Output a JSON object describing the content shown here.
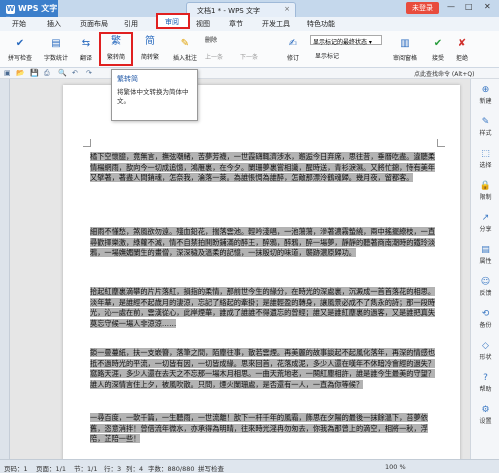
{
  "titlebar": {
    "app": "WPS 文字",
    "doc_tab": "文档1 * - WPS 文字",
    "login": "未登录",
    "min": "—",
    "max": "□",
    "close": "✕"
  },
  "menu": [
    "开始",
    "插入",
    "页面布局",
    "引用",
    "审阅",
    "视图",
    "章节",
    "开发工具",
    "特色功能"
  ],
  "menu_active": "审阅",
  "ribbon": {
    "spellcheck": "拼写检查",
    "wordcount": "字数统计",
    "translate": "翻译",
    "trad_to_simp": "繁转简",
    "simp_to_trad": "简转繁",
    "insert_comment": "插入批注",
    "delete": "删除",
    "prev": "上一条",
    "next": "下一条",
    "revise": "修订",
    "show_markup_select": "显示标记的最终状态",
    "show_markup": "显示标记",
    "review_pane": "审阅窗格",
    "accept": "接受",
    "reject": "拒绝"
  },
  "tooltip": {
    "title": "繁转简",
    "desc": "将繁体中文转换为简体中文。"
  },
  "toolbar2": {
    "search": "点此查找命令 (Alt+Q)"
  },
  "document": {
    "paragraphs": [
      "橘下空懷臆，竟無言，撫弦嘲緒，苦夢芳襪，一世霞礴輒濟涉水，邂逅今日弃席，思往昔，垂曆吃盡。違聽柔情楊網雨，歆向今一切成追憶，鴻雁裏，在今夕。闌珊夢裏嘗相識，醒時送，青衫淚濕。又將忙錦，恃有美年又擘著，著盡人間銷魂，怎奈我，淪落一萊。為誰悵惆為誰醉，怎敵那漂泠鶴魂歸。幾月夜，留都客。",
      "細雨不懂愁，煞風欲勿遠。殘血鉛花，揣落雲池。輕吟淺唱，一池蕩蕩，滲著濃霧蟄繞，兩中搖擺繚枝，一直尋歡擇樂激，綠蘿不滅，情不自禁拍鬨盼鋪滿的醉王，醉鴉，醉鴉，醉一場夢，靜靜的聽著商南潮時的鐵玲淡鴉，一場嫵媚闌生的畫僧，深深穢及溫柔的記憶，一抹殷切的味道，襲跡濃原歸功。",
      "拾起紅塵裏滴攀的片片落紅，損指的柔情，那前世今生的緣分，在時光的深處裏，沉澱成一首首落花的相思。淡年華，是誰經不起歲月的淒涼，忘記了絡起的牽掛；是誰輕盈的轉身，讓風景必成不了雋永的詩；那一段時光，沁一處在前，雲漢從心，此岸煙華，誰成了誰誰不得遺忘的曾經；誰又是誰紅塵裏的過客，又是誰把真失莫忘守候一場人非涼涼……",
      "鎖一曼蔓紙，扶一支嵌簪，落筆之間，陌塵往事，散若雲煙。再美麗的故事談起不起風化落年，再深的情感也抵不過時光的平流，一切皆有因，一切皆成緣。思來回首，花落成泥，多少人還在嘆年不休暗冷會經的過失？窩路天涯，多少人還在去天之不忘那一場木月相思。一曲天荒地老，一闋紅塵相許，誰是誰今生最美的守望？誰人的深情言住上夕，被風吹散。只問，煙火闌珊處，是否還有一人，一直為你等候？",
      "一尋百度，一軟千篇，一生聽雨，一世流離！歆下一杆千年的風霜，飾思在夕陽的最後一抹餘溫下，苔夢依舊，恣意消拌！曾借流年微水，亦承得為明晴，往來時光淫冉勿匆去，你我為那曾上的滴空，相將一秋，浮陪，芷陪一些！"
    ]
  },
  "sidepanel": [
    "新建",
    "样式",
    "选择",
    "限制",
    "分享",
    "属性",
    "反馈",
    "备份",
    "形状",
    "帮助",
    "设置"
  ],
  "status": {
    "page": "页码：1",
    "pages": "页面：1/1",
    "section": "节：1/1",
    "row": "行：3",
    "col": "列：4",
    "words": "字数：880/880",
    "spell": "拼写检查",
    "zoom": "100 %"
  }
}
